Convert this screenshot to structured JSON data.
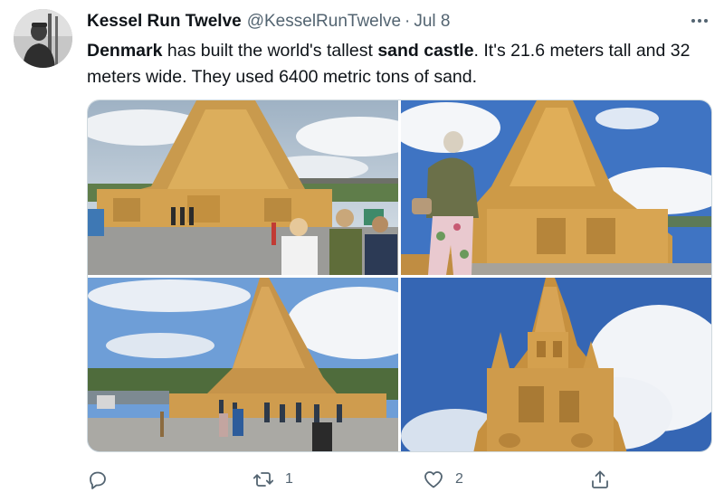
{
  "tweet": {
    "author": {
      "display_name": "Kessel Run Twelve",
      "handle": "@KesselRunTwelve",
      "separator": "·",
      "date": "Jul 8"
    },
    "text": {
      "part1_bold": "Denmark",
      "part2": " has built the world's tallest ",
      "part3_bold": "sand castle",
      "part4": ". It's 21.6 meters tall and 32 meters wide. They used 6400 metric tons of sand."
    },
    "actions": {
      "reply_count": "",
      "retweet_count": "1",
      "like_count": "2"
    }
  },
  "icons": {
    "more": "more-horizontal-icon",
    "reply": "reply-icon",
    "retweet": "retweet-icon",
    "like": "heart-icon",
    "share": "share-icon"
  },
  "colors": {
    "text_primary": "#0f1419",
    "text_secondary": "#536471",
    "border": "#cfd9de",
    "sand": "#d9a24a"
  }
}
